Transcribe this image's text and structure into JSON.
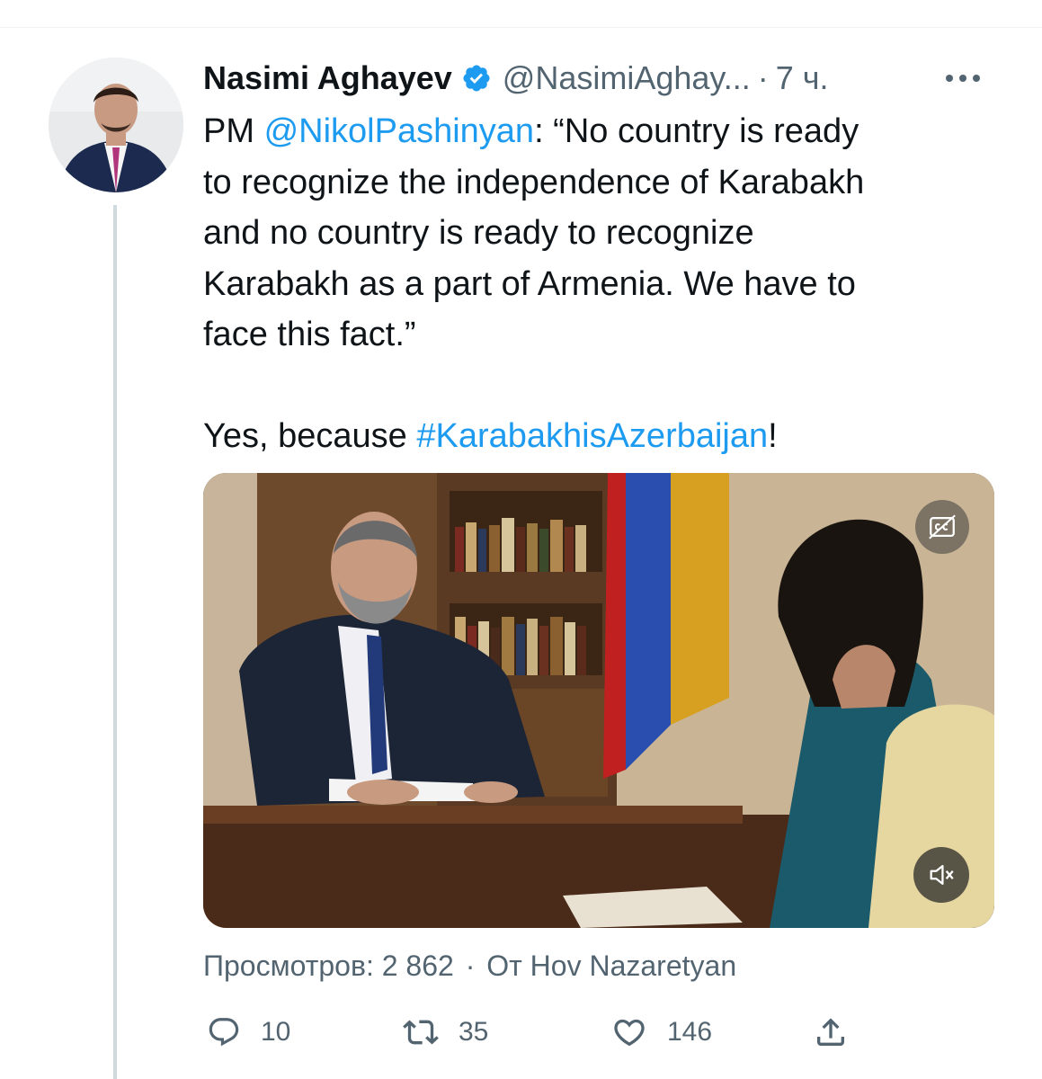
{
  "author": {
    "display_name": "Nasimi Aghayev",
    "handle": "@NasimiAghay...",
    "separator": "·",
    "time": "7 ч."
  },
  "tweet": {
    "prefix": "PM ",
    "mention": "@NikolPashinyan",
    "line1_rest": ": “No country is ready",
    "line2": "to recognize the independence of Karabakh",
    "line3": "and no country is ready to recognize",
    "line4": "Karabakh as a part of Armenia. We have to",
    "line5": "face this fact.”",
    "line6_prefix": "Yes, because ",
    "hashtag": "#KarabakhisAzerbaijan",
    "line6_suffix": "!"
  },
  "media": {
    "cc_icon": "closed-captions-icon",
    "mute_icon": "volume-muted-icon"
  },
  "meta": {
    "views": "Просмотров: 2 862",
    "separator": "·",
    "source": "От Hov Nazaretyan"
  },
  "actions": {
    "reply_count": "10",
    "retweet_count": "35",
    "like_count": "146"
  },
  "colors": {
    "link": "#1d9bf0",
    "secondary_text": "#536471",
    "primary_text": "#0f1419",
    "verified_badge": "#1d9bf0"
  }
}
